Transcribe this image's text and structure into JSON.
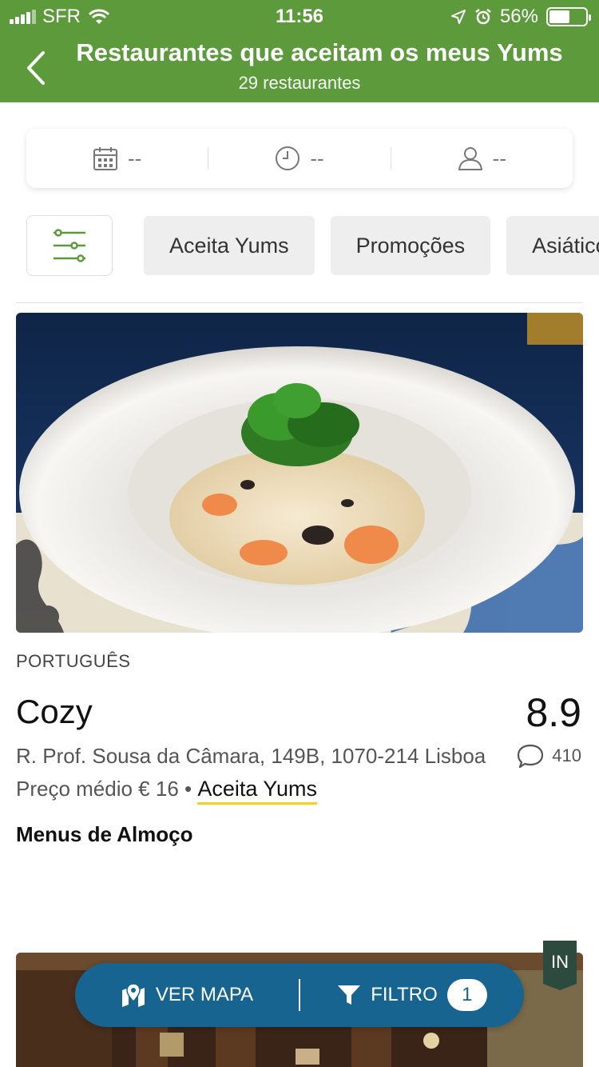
{
  "status_bar": {
    "carrier": "SFR",
    "time": "11:56",
    "battery": "56%",
    "battery_level": 0.56
  },
  "header": {
    "title": "Restaurantes que aceitam os meus Yums",
    "subtitle": "29 restaurantes"
  },
  "search_summary": {
    "date": "--",
    "time": "--",
    "people": "--"
  },
  "filter_chips": [
    "Aceita Yums",
    "Promoções",
    "Asiático"
  ],
  "restaurant": {
    "cuisine": "PORTUGUÊS",
    "name": "Cozy",
    "rating": "8.9",
    "address": "R. Prof. Sousa da Câmara, 149B, 1070-214 Lisboa",
    "review_count": "410",
    "price_label": "Preço médio € 16",
    "separator": "•",
    "yums_label": "Aceita Yums",
    "menus_label": "Menus de Almoço"
  },
  "next_badge": "IN",
  "action_bar": {
    "map_label": "VER MAPA",
    "filter_label": "FILTRO",
    "filter_count": "1"
  },
  "colors": {
    "header_green": "#5c9a3c",
    "action_blue": "#16648f",
    "yums_underline": "#f2d21b",
    "badge_dark_green": "#2c4a3e"
  }
}
